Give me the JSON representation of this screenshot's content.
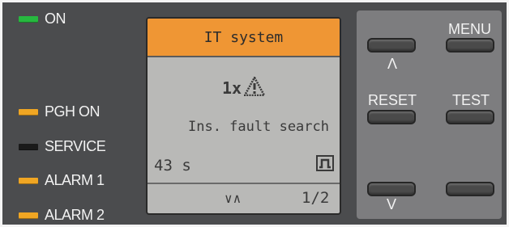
{
  "leds": [
    {
      "label": "ON",
      "color": "#27b83f"
    },
    {
      "label": "PGH ON",
      "color": "#f0a623"
    },
    {
      "label": "SERVICE",
      "color": "#1a1a1a"
    },
    {
      "label": "ALARM 1",
      "color": "#f0a623"
    },
    {
      "label": "ALARM 2",
      "color": "#f0a623"
    }
  ],
  "display": {
    "header": "IT system",
    "fault_count": "1x",
    "fault_icon": "warning-triangle-icon",
    "message": "Ins. fault search",
    "timer": "43 s",
    "status_icon": "pulse-signal-icon",
    "nav_arrows": "∨∧",
    "page": "1/2"
  },
  "buttons": {
    "menu": "MENU",
    "up": "Λ",
    "reset": "RESET",
    "test": "TEST",
    "down": "V"
  },
  "colors": {
    "panel": "#4b4c4e",
    "display_header": "#ef9634",
    "display_bg": "#b9b9b7",
    "keypad_bg": "#7d7d7f"
  }
}
